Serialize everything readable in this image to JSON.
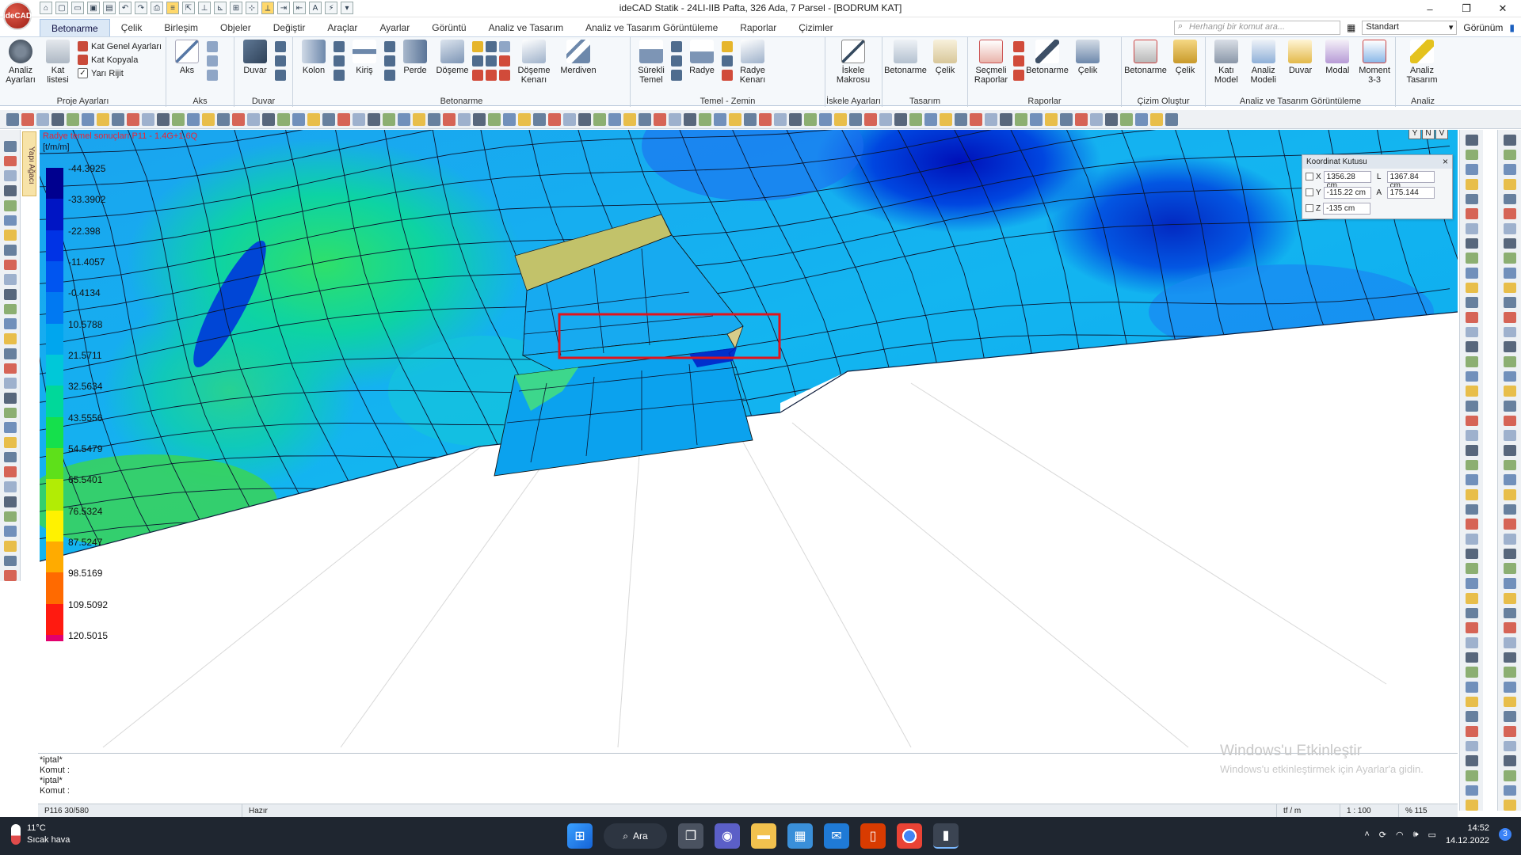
{
  "app": {
    "logo": "ideCAD",
    "title": "ideCAD Statik - 24LI-IIB  Pafta, 326 Ada, 7 Parsel - [BODRUM KAT]",
    "window_controls": [
      "–",
      "❐",
      "✕"
    ]
  },
  "tabs": [
    "Betonarme",
    "Çelik",
    "Birleşim",
    "Objeler",
    "Değiştir",
    "Araçlar",
    "Ayarlar",
    "Görüntü",
    "Analiz ve Tasarım",
    "Analiz ve Tasarım Görüntüleme",
    "Raporlar",
    "Çizimler"
  ],
  "search": {
    "placeholder": "Herhangi bir komut ara..."
  },
  "style_select": "Standart",
  "view_menu": "Görünüm",
  "ribbon": {
    "proje": {
      "label": "Proje Ayarları",
      "analiz_ayarlari": "Analiz Ayarları",
      "kat_listesi": "Kat listesi",
      "kat_genel": "Kat Genel Ayarları",
      "kat_kopyala": "Kat Kopyala",
      "yari_rijit": "Yarı Rijit"
    },
    "aks": {
      "label": "Aks",
      "aks": "Aks"
    },
    "duvar": {
      "label": "Duvar",
      "duvar": "Duvar"
    },
    "betonarme": {
      "label": "Betonarme",
      "kolon": "Kolon",
      "kiris": "Kiriş",
      "perde": "Perde",
      "doseme": "Döşeme",
      "doseme_kenari": "Döşeme Kenarı",
      "merdiven": "Merdiven"
    },
    "temel": {
      "label": "Temel - Zemin",
      "surekli": "Sürekli Temel",
      "radye": "Radye",
      "radye_kenari": "Radye Kenarı"
    },
    "iskele": {
      "label": "İskele Ayarları",
      "makrosu": "İskele Makrosu"
    },
    "tasarim": {
      "label": "Tasarım",
      "betonarme": "Betonarme",
      "celik": "Çelik"
    },
    "raporlar": {
      "label": "Raporlar",
      "secmeli": "Seçmeli Raporlar",
      "betonarme": "Betonarme",
      "celik": "Çelik"
    },
    "cizim": {
      "label": "Çizim Oluştur",
      "betonarme": "Betonarme",
      "celik": "Çelik"
    },
    "agt": {
      "label": "Analiz ve Tasarım Görüntüleme",
      "kati_model": "Katı Model",
      "analiz_modeli": "Analiz Modeli",
      "duvar": "Duvar",
      "modal": "Modal",
      "moment": "Moment 3-3"
    },
    "analiz": {
      "label": "Analiz",
      "tasarim": "Analiz Tasarım"
    }
  },
  "side_tab": "Yapı Ağacı",
  "viewport": {
    "status": "Radye temel sonuçları  P11 - 1.4G+1.6Q",
    "unit": "[t/m/m]",
    "view_buttons": [
      "Y",
      "N",
      "V"
    ],
    "legend": [
      "-44.3925",
      "-33.3902",
      "-22.398",
      "-11.4057",
      "-0.4134",
      "10.5788",
      "21.5711",
      "32.5634",
      "43.5556",
      "54.5479",
      "65.5401",
      "76.5324",
      "87.5247",
      "98.5169",
      "109.5092",
      "120.5015"
    ],
    "legend_colors": [
      "#00008f",
      "#0015c4",
      "#0033e5",
      "#0055f0",
      "#0079f2",
      "#00a6ee",
      "#00c8d8",
      "#00d89a",
      "#15e04c",
      "#5ee01a",
      "#b2ec05",
      "#fff200",
      "#ffab00",
      "#ff6a00",
      "#ff1a10",
      "#e2006e"
    ]
  },
  "coord_box": {
    "title": "Koordinat Kutusu",
    "x_label": "X",
    "x": "1356.28 cm",
    "y_label": "Y",
    "y": "-115.22 cm",
    "z_label": "Z",
    "z": "-135 cm",
    "l_label": "L",
    "l": "1367.84 cm",
    "a_label": "A",
    "a": "175.144"
  },
  "command": {
    "lines": [
      "*iptal*",
      "Komut :",
      "*iptal*",
      "Komut :"
    ]
  },
  "watermark": {
    "title": "Windows'u Etkinleştir",
    "body": "Windows'u etkinleştirmek için Ayarlar'a gidin."
  },
  "status": {
    "cursor": "P116 30/580",
    "state": "Hazır",
    "unit": "tf / m",
    "scale": "1 : 100",
    "zoom": "% 115"
  },
  "taskbar": {
    "temp": "11°C",
    "weather": "Sıcak hava",
    "search": "Ara",
    "time": "14:52",
    "date": "14.12.2022",
    "notifications": "3"
  }
}
